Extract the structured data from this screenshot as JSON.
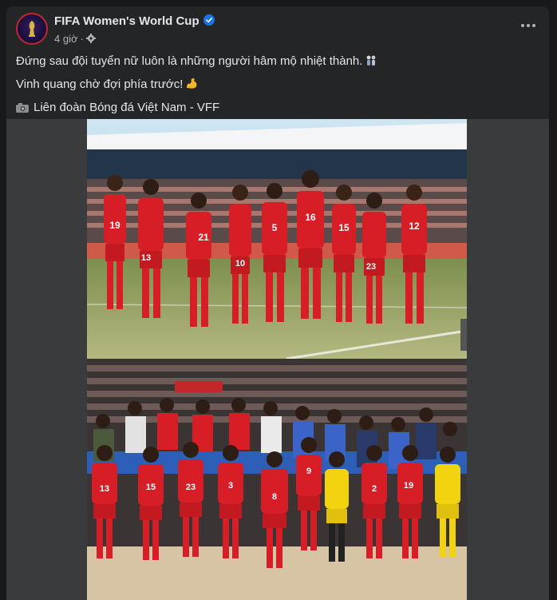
{
  "post": {
    "page_name": "FIFA Women's World Cup",
    "time": "4 giờ",
    "lines": [
      "Đứng sau đội tuyển nữ luôn là những người hâm mộ nhiệt thành.",
      "Vinh quang chờ đợi phía trước!",
      "Liên đoàn Bóng đá Việt Nam - VFF"
    ],
    "line_icons": [
      "women-wrestling-emoji",
      "flexed-biceps-emoji",
      "camera-emoji"
    ]
  },
  "photo_top": {
    "shirt_numbers": [
      "19",
      "13",
      "21",
      "5",
      "16",
      "15",
      "12",
      "10",
      "23"
    ]
  },
  "photo_bottom": {
    "shirt_numbers": [
      "13",
      "15",
      "23",
      "3",
      "8",
      "9",
      "2",
      "19"
    ]
  },
  "colors": {
    "card_bg": "#242526",
    "page_bg": "#18191a",
    "text": "#e4e6eb",
    "secondary_text": "#b0b3b8",
    "verified_blue": "#1b74e4",
    "kit_red": "#d71d25",
    "kit_yellow": "#f2d310"
  }
}
